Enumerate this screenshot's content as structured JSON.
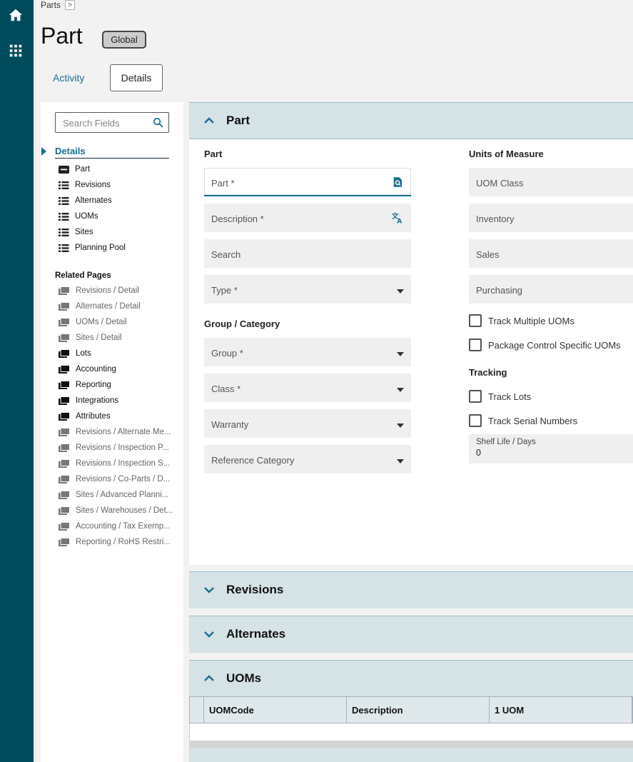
{
  "breadcrumb": {
    "label": "Parts",
    "arrow": ">"
  },
  "page": {
    "title": "Part",
    "badge": "Global"
  },
  "tabs": {
    "activity": "Activity",
    "details": "Details"
  },
  "nav": {
    "search_placeholder": "Search Fields",
    "details_header": "Details",
    "detail_items": [
      {
        "label": "Part",
        "icon": "card-icon"
      },
      {
        "label": "Revisions",
        "icon": "list-icon"
      },
      {
        "label": "Alternates",
        "icon": "list-icon"
      },
      {
        "label": "UOMs",
        "icon": "list-icon"
      },
      {
        "label": "Sites",
        "icon": "list-icon"
      },
      {
        "label": "Planning Pool",
        "icon": "list-icon"
      }
    ],
    "related_title": "Related Pages",
    "related_items": [
      {
        "label": "Revisions / Detail",
        "enabled": false
      },
      {
        "label": "Alternates / Detail",
        "enabled": false
      },
      {
        "label": "UOMs / Detail",
        "enabled": false
      },
      {
        "label": "Sites / Detail",
        "enabled": false
      },
      {
        "label": "Lots",
        "enabled": true
      },
      {
        "label": "Accounting",
        "enabled": true
      },
      {
        "label": "Reporting",
        "enabled": true
      },
      {
        "label": "Integrations",
        "enabled": true
      },
      {
        "label": "Attributes",
        "enabled": true
      },
      {
        "label": "Revisions / Alternate Me...",
        "enabled": false
      },
      {
        "label": "Revisions / Inspection P...",
        "enabled": false
      },
      {
        "label": "Revisions / Inspection S...",
        "enabled": false
      },
      {
        "label": "Revisions / Co-Parts / D...",
        "enabled": false
      },
      {
        "label": "Sites / Advanced Planni...",
        "enabled": false
      },
      {
        "label": "Sites / Warehouses / Det...",
        "enabled": false
      },
      {
        "label": "Accounting / Tax Exemp...",
        "enabled": false
      },
      {
        "label": "Reporting / RoHS Restri...",
        "enabled": false
      }
    ]
  },
  "part_card": {
    "title": "Part",
    "part_section": "Part",
    "fields": {
      "part": "Part *",
      "description": "Description *",
      "search": "Search",
      "type": "Type *"
    },
    "group_section": "Group / Category",
    "group_fields": {
      "group": "Group *",
      "class": "Class *",
      "warranty": "Warranty",
      "reference_category": "Reference Category"
    },
    "uom_section": "Units of Measure",
    "uom_fields": {
      "uom_class": "UOM Class",
      "inventory": "Inventory",
      "sales": "Sales",
      "purchasing": "Purchasing"
    },
    "checks": {
      "track_multiple": "Track Multiple UOMs",
      "package_control": "Package Control Specific UOMs"
    },
    "tracking_section": "Tracking",
    "tracking_checks": {
      "track_lots": "Track Lots",
      "track_serial": "Track Serial Numbers"
    },
    "shelf_life": {
      "label": "Shelf Life / Days",
      "value": "0"
    }
  },
  "cards": {
    "revisions": "Revisions",
    "alternates": "Alternates",
    "uoms": "UOMs"
  },
  "uom_table": {
    "columns": [
      "UOMCode",
      "Description",
      "1 UOM"
    ]
  },
  "colors": {
    "rail": "#004c5c",
    "accent": "#1a6e8e",
    "card": "#d5e2e6"
  }
}
